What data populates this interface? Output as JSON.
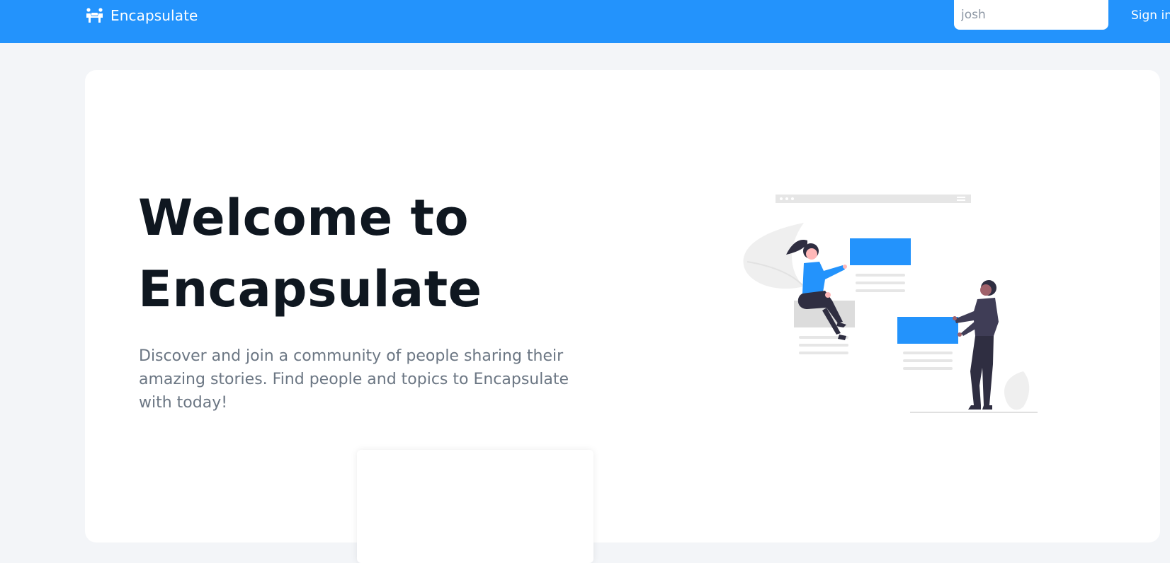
{
  "navbar": {
    "brand_name": "Encapsulate",
    "brand_icon": "people-group-icon",
    "search_value": "josh",
    "signin_label": "Sign in",
    "color": "#2393fc"
  },
  "hero": {
    "title": "Welcome to Encapsulate",
    "subtitle": "Discover and join a community of people sharing their amazing stories. Find people and topics to Encapsulate with today!",
    "illustration": "community-illustration"
  },
  "colors": {
    "accent": "#2393fc",
    "page_bg": "#f3f5f8",
    "title": "#0f1720",
    "subtitle": "#6b7683"
  }
}
